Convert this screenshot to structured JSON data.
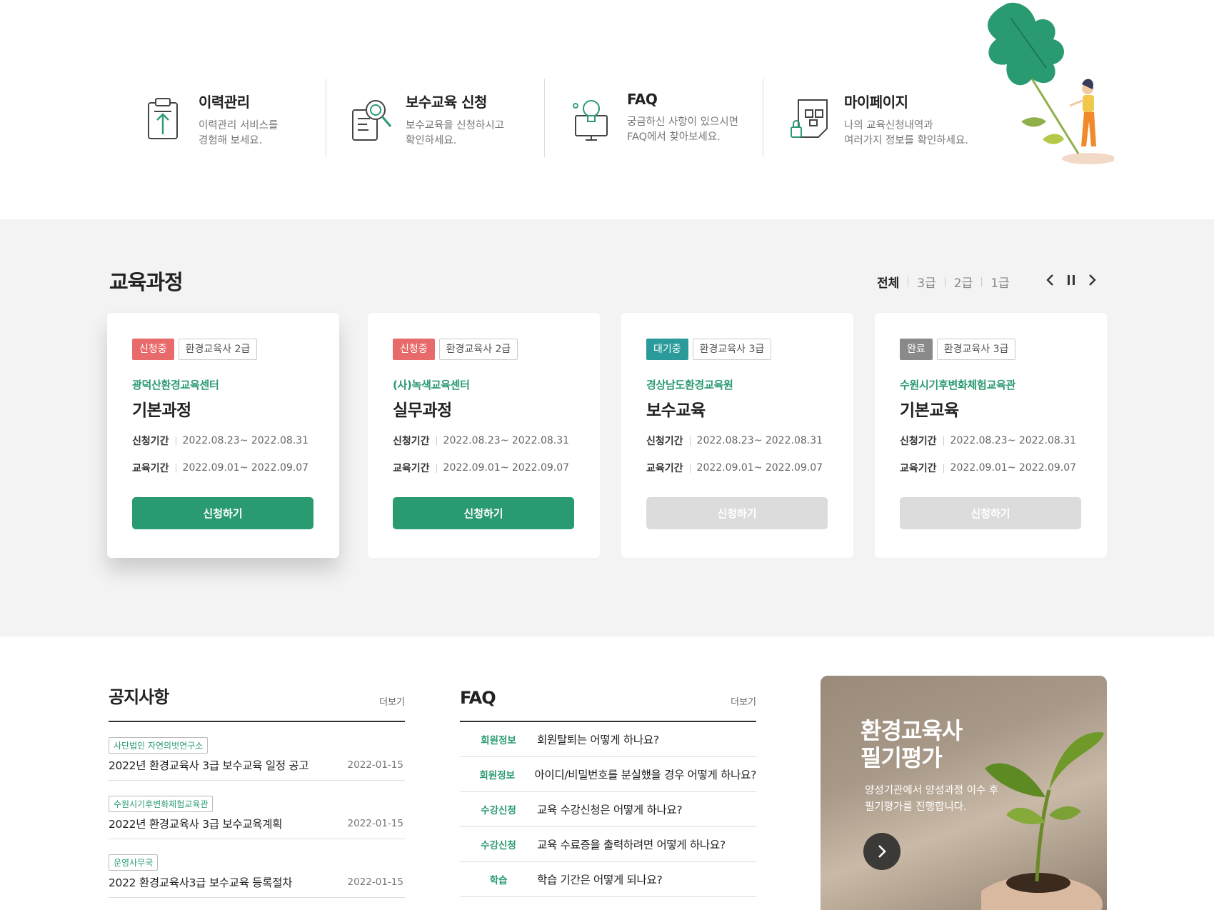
{
  "quick_menu": [
    {
      "title": "이력관리",
      "desc": "이력관리 서비스를\n경험해 보세요.",
      "icon": "clipboard-upload-icon"
    },
    {
      "title": "보수교육 신청",
      "desc": "보수교육을 신청하시고\n확인하세요.",
      "icon": "document-search-icon"
    },
    {
      "title": "FAQ",
      "desc": "궁금하신 사항이 있으시면\nFAQ에서 찾아보세요.",
      "icon": "lightbulb-monitor-icon"
    },
    {
      "title": "마이페이지",
      "desc": "나의 교육신청내역과\n여러가지 정보를 확인하세요.",
      "icon": "lock-document-icon"
    }
  ],
  "courses": {
    "title": "교육과정",
    "filters": [
      "전체",
      "3급",
      "2급",
      "1급"
    ],
    "active_filter": "전체",
    "cards": [
      {
        "status": "신청중",
        "status_color": "#e96a6a",
        "grade": "환경교육사 2급",
        "org": "광덕산환경교육센터",
        "name": "기본과정",
        "apply_label": "신청기간",
        "apply_period": "2022.08.23~ 2022.08.31",
        "edu_label": "교육기간",
        "edu_period": "2022.09.01~ 2022.09.07",
        "button": "신청하기",
        "enabled": true
      },
      {
        "status": "신청중",
        "status_color": "#e96a6a",
        "grade": "환경교육사 2급",
        "org": "(사)녹색교육센터",
        "name": "실무과정",
        "apply_label": "신청기간",
        "apply_period": "2022.08.23~ 2022.08.31",
        "edu_label": "교육기간",
        "edu_period": "2022.09.01~ 2022.09.07",
        "button": "신청하기",
        "enabled": true
      },
      {
        "status": "대기중",
        "status_color": "#2a9a9a",
        "grade": "환경교육사 3급",
        "org": "경상남도환경교육원",
        "name": "보수교육",
        "apply_label": "신청기간",
        "apply_period": "2022.08.23~ 2022.08.31",
        "edu_label": "교육기간",
        "edu_period": "2022.09.01~ 2022.09.07",
        "button": "신청하기",
        "enabled": false
      },
      {
        "status": "완료",
        "status_color": "#8a8a8a",
        "grade": "환경교육사 3급",
        "org": "수원시기후변화체험교육관",
        "name": "기본교육",
        "apply_label": "신청기간",
        "apply_period": "2022.08.23~ 2022.08.31",
        "edu_label": "교육기간",
        "edu_period": "2022.09.01~ 2022.09.07",
        "button": "신청하기",
        "enabled": false
      }
    ]
  },
  "notice": {
    "title": "공지사항",
    "more": "더보기",
    "items": [
      {
        "tag": "사단법인 자연의벗연구소",
        "title": "2022년 환경교육사 3급 보수교육 일정 공고",
        "date": "2022-01-15"
      },
      {
        "tag": "수원시기후변화체험교육관",
        "title": "2022년 환경교육사 3급 보수교육계획",
        "date": "2022-01-15"
      },
      {
        "tag": "운영사무국",
        "title": "2022 환경교육사3급 보수교육 등록절차",
        "date": "2022-01-15"
      }
    ]
  },
  "faq": {
    "title": "FAQ",
    "more": "더보기",
    "items": [
      {
        "cat": "회원정보",
        "q": "회원탈퇴는 어떻게 하나요?"
      },
      {
        "cat": "회원정보",
        "q": "아이디/비밀번호를 분실했을 경우 어떻게 하나요?"
      },
      {
        "cat": "수강신청",
        "q": "교육 수강신청은 어떻게 하나요?"
      },
      {
        "cat": "수강신청",
        "q": "교육 수료증을 출력하려면 어떻게 하나요?"
      },
      {
        "cat": "학습",
        "q": "학습 기간은 어떻게 되나요?"
      }
    ]
  },
  "banner": {
    "title": "환경교육사\n필기평가",
    "desc": "양성기관에서 양성과정 이수 후\n필기평가를 진행합니다."
  },
  "colors": {
    "primary": "#2a9a70",
    "disabled": "#dcdcdc",
    "section_bg": "#f3f3f3"
  }
}
